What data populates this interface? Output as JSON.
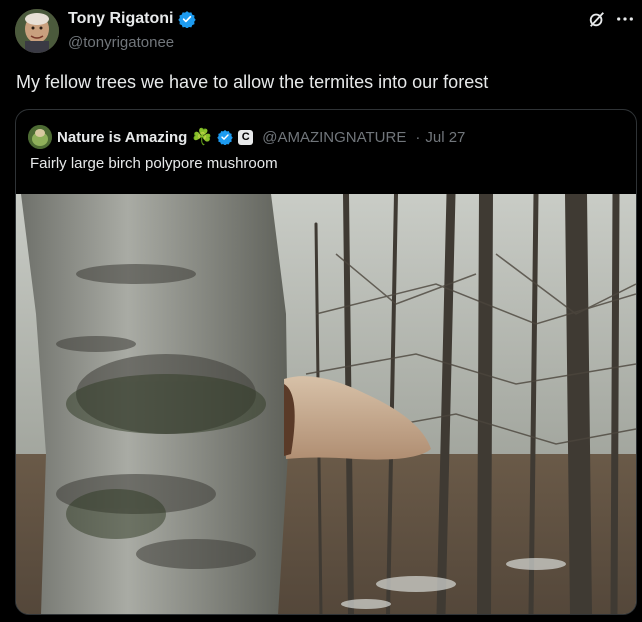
{
  "tweet": {
    "author_name": "Tony Rigatoni",
    "author_handle": "@tonyrigatonee",
    "text": "My fellow trees we have to allow the termites into our forest"
  },
  "top_icons": [
    "grok-icon",
    "more-icon"
  ],
  "quoted_tweet": {
    "author_name": "Nature is Amazing",
    "name_emoji": "☘️",
    "author_handle": "@AMAZINGNATURE",
    "separator": "·",
    "date": "Jul 27",
    "text": "Fairly large birch polypore mushroom",
    "badge_letter": "C"
  },
  "colors": {
    "background": "#000000",
    "text": "#e7e9ea",
    "secondary": "#71767b",
    "verified": "#1d9bf0",
    "border": "#2f3336"
  }
}
